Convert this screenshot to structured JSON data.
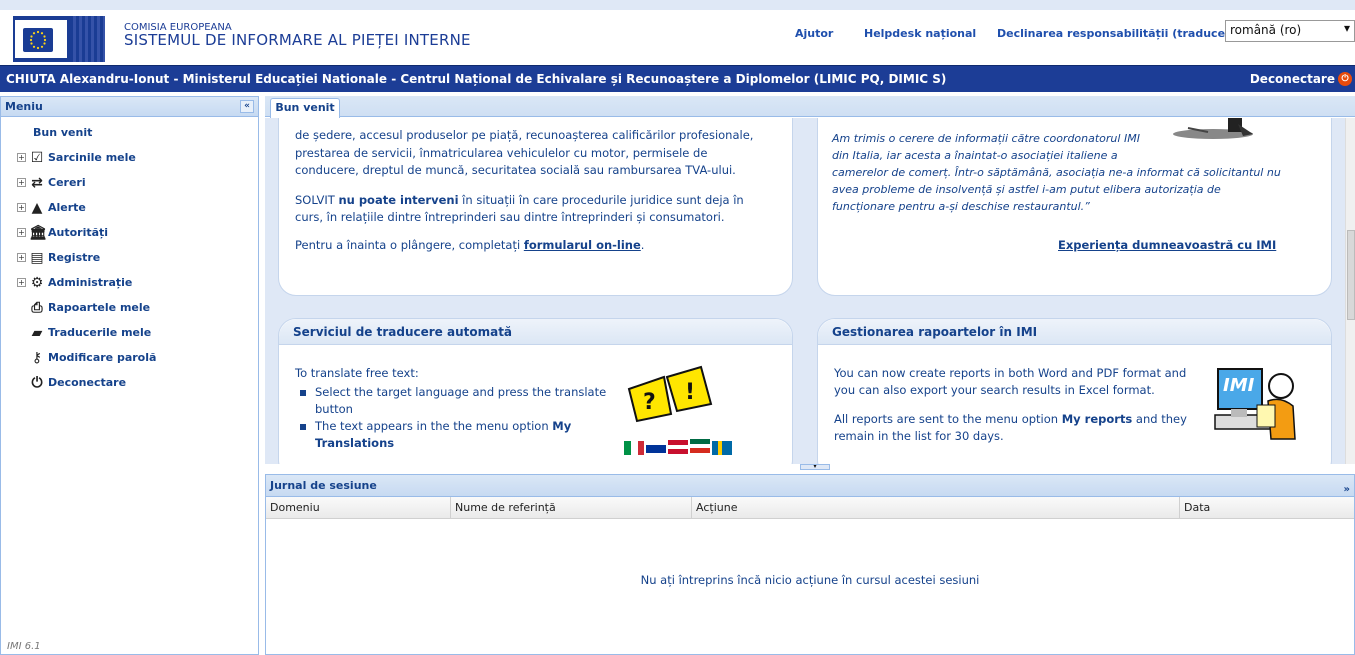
{
  "header": {
    "org_small": "COMISIA EUROPEANA",
    "system_title": "SISTEMUL DE INFORMARE AL PIEȚEI INTERNE",
    "links": {
      "help": "Ajutor",
      "helpdesk": "Helpdesk național",
      "disclaimer": "Declinarea responsabilității (traducere)"
    },
    "language": "română (ro)"
  },
  "userbar": {
    "user": "CHIUTA Alexandru-Ionut - Ministerul Educației Nationale - Centrul Național de Echivalare și Recunoaștere a Diplomelor (LIMIC PQ, DIMIC S)",
    "logout": "Deconectare"
  },
  "sidebar": {
    "title": "Meniu",
    "items": [
      {
        "label": "Bun venit"
      },
      {
        "label": "Sarcinile mele",
        "icon": "tasks-icon"
      },
      {
        "label": "Cereri",
        "icon": "exchange-icon"
      },
      {
        "label": "Alerte",
        "icon": "warning-icon"
      },
      {
        "label": "Autorități",
        "icon": "building-icon"
      },
      {
        "label": "Registre",
        "icon": "document-icon"
      },
      {
        "label": "Administrație",
        "icon": "gear-icon"
      },
      {
        "label": "Rapoartele mele",
        "icon": "print-icon"
      },
      {
        "label": "Traducerile mele",
        "icon": "chat-icon"
      },
      {
        "label": "Modificare parolă",
        "icon": "key-icon"
      },
      {
        "label": "Deconectare",
        "icon": "power-icon"
      }
    ],
    "version": "IMI 6.1"
  },
  "tabs": {
    "active": "Bun venit"
  },
  "panels": {
    "solvit": {
      "line1": "de ședere, accesul produselor pe piață, recunoașterea calificărilor profesionale,",
      "line2": "prestarea de servicii, înmatricularea vehiculelor cu motor, permisele de",
      "line3": "conducere, dreptul de muncă, securitatea socială sau rambursarea TVA-ului.",
      "p2_pre": "SOLVIT ",
      "p2_bold": "nu poate interveni",
      "p2_post": " în situații în care procedurile juridice sunt deja în",
      "p2_line2": "curs, în relațiile dintre întreprinderi sau dintre întreprinderi și consumatori.",
      "p3_pre": "Pentru a înainta o plângere, completați ",
      "p3_link": "formularul on-line",
      "p3_post": "."
    },
    "experience": {
      "q1": "Am trimis o cerere de informații către coordonatorul IMI",
      "q2": "din Italia, iar acesta a înaintat-o asociației italiene a",
      "q3": "camerelor de comerț. Într-o săptămână, asociația ne-a informat că solicitantul nu",
      "q4": "avea probleme de insolvență și astfel i-am putut elibera autorizația de",
      "q5": "funcționare pentru a-și deschise restaurantul.”",
      "link": "Experiența dumneavoastră cu IMI"
    },
    "translation": {
      "title": "Serviciul de traducere automată",
      "intro": "To translate free text:",
      "b1a": "Select the target language and press the translate",
      "b1b": "button",
      "b2_pre": "The text appears in the the menu option ",
      "b2_bold1": "My",
      "b2_bold2": "Translations"
    },
    "reports": {
      "title": "Gestionarea rapoartelor în IMI",
      "l1": "You can now create reports in both Word and PDF format and",
      "l2": "you can also export your search results in Excel format.",
      "l3_pre": "All reports are sent to the menu option ",
      "l3_bold": "My reports",
      "l3_post": " and they",
      "l4": "remain in the list for 30 days.",
      "logo_text": "IMI"
    }
  },
  "journal": {
    "title": "Jurnal de sesiune",
    "columns": [
      "Domeniu",
      "Nume de referință",
      "Acțiune",
      "Data"
    ],
    "empty": "Nu ați întreprins încă nicio acțiune în cursul acestei sesiuni"
  }
}
